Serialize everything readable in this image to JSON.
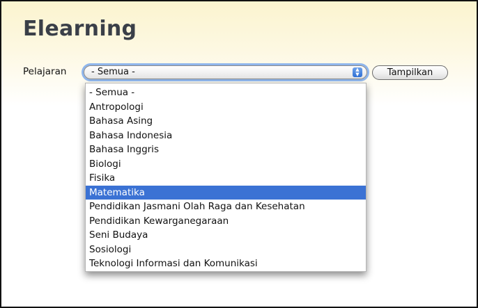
{
  "page": {
    "title": "Elearning"
  },
  "filter": {
    "label": "Pelajaran",
    "selected_value": "- Semua -",
    "button_label": "Tampilkan"
  },
  "dropdown": {
    "highlighted": "Matematika",
    "options": [
      {
        "label": "- Semua -",
        "selected": false
      },
      {
        "label": "Antropologi",
        "selected": false
      },
      {
        "label": "Bahasa Asing",
        "selected": false
      },
      {
        "label": "Bahasa Indonesia",
        "selected": false
      },
      {
        "label": "Bahasa Inggris",
        "selected": false
      },
      {
        "label": "Biologi",
        "selected": false
      },
      {
        "label": "Fisika",
        "selected": false
      },
      {
        "label": "Matematika",
        "selected": true
      },
      {
        "label": "Pendidikan Jasmani Olah Raga dan Kesehatan",
        "selected": false
      },
      {
        "label": "Pendidikan Kewarganegaraan",
        "selected": false
      },
      {
        "label": "Seni Budaya",
        "selected": false
      },
      {
        "label": "Sosiologi",
        "selected": false
      },
      {
        "label": "Teknologi Informasi dan Komunikasi",
        "selected": false
      }
    ]
  },
  "colors": {
    "highlight": "#3b72d4",
    "focus_ring": "#8fb6ec",
    "header_tint": "#fbf4cf",
    "title_text": "#3a3f48"
  },
  "icons": {
    "select_arrows": "updown-arrows-icon"
  }
}
